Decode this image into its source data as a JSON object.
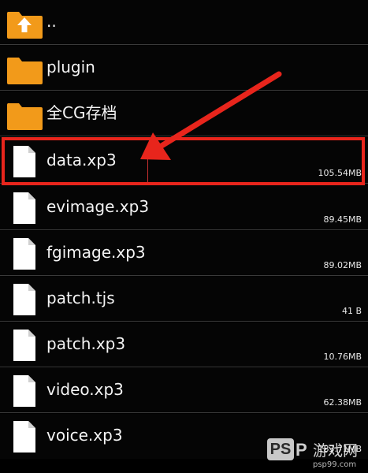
{
  "file_list": {
    "items": [
      {
        "type": "parent",
        "icon": "folder-up-icon",
        "name": "..",
        "size": ""
      },
      {
        "type": "folder",
        "icon": "folder-icon",
        "name": "plugin",
        "size": ""
      },
      {
        "type": "folder",
        "icon": "folder-icon",
        "name": "全CG存档",
        "size": ""
      },
      {
        "type": "file",
        "icon": "file-icon",
        "name": "data.xp3",
        "size": "105.54MB",
        "highlighted": true
      },
      {
        "type": "file",
        "icon": "file-icon",
        "name": "evimage.xp3",
        "size": "89.45MB"
      },
      {
        "type": "file",
        "icon": "file-icon",
        "name": "fgimage.xp3",
        "size": "89.02MB"
      },
      {
        "type": "file",
        "icon": "file-icon",
        "name": "patch.tjs",
        "size": "41 B"
      },
      {
        "type": "file",
        "icon": "file-icon",
        "name": "patch.xp3",
        "size": "10.76MB"
      },
      {
        "type": "file",
        "icon": "file-icon",
        "name": "video.xp3",
        "size": "62.38MB"
      },
      {
        "type": "file",
        "icon": "file-icon",
        "name": "voice.xp3",
        "size": "183.71MB"
      }
    ]
  },
  "annotation": {
    "color": "#e8251c",
    "arrow_target": "data.xp3"
  },
  "watermark": {
    "logo": "PS",
    "logo_extra": "P",
    "name": "游戏网",
    "url": "psp99.com"
  },
  "colors": {
    "folder": "#f29a1a",
    "file": "#ffffff",
    "background": "#050505",
    "divider": "#3a3a3a"
  }
}
